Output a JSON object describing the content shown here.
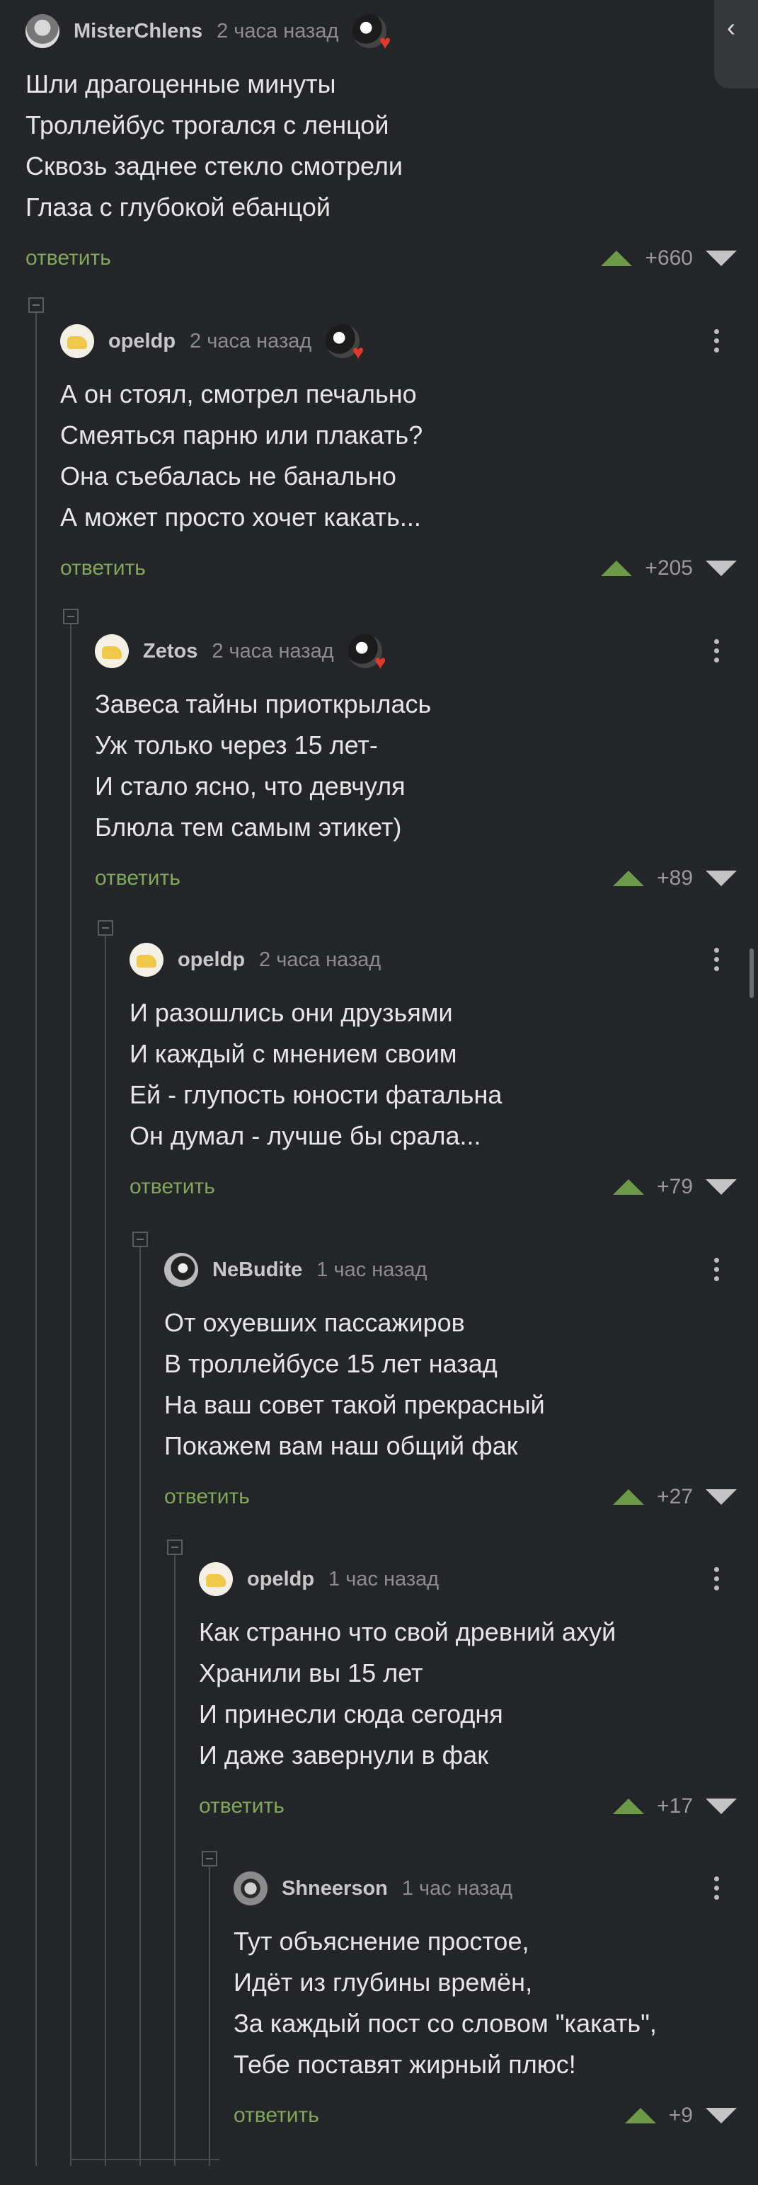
{
  "reply_label": "ответить",
  "comments": [
    {
      "nick": "MisterChlens",
      "time": "2 часа назад",
      "score": "+660",
      "lines": [
        "Шли драгоценные минуты",
        "Троллейбус трогался с ленцой",
        "Сквозь заднее стекло смотрели",
        "Глаза с глубокой ебанцой"
      ]
    },
    {
      "nick": "opeldp",
      "time": "2 часа назад",
      "score": "+205",
      "lines": [
        "А он стоял, смотрел печально",
        "Смеяться парню или плакать?",
        "Она съебалась не банально",
        "А может просто хочет какать..."
      ]
    },
    {
      "nick": "Zetos",
      "time": "2 часа назад",
      "score": "+89",
      "lines": [
        "Завеса тайны приоткрылась",
        "Уж только через 15 лет-",
        "И стало ясно, что девчуля",
        "Блюла тем самым этикет)"
      ]
    },
    {
      "nick": "opeldp",
      "time": "2 часа назад",
      "score": "+79",
      "lines": [
        "И разошлись они друзьями",
        "И каждый с мнением своим",
        "Ей - глупость юности фатальна",
        "Он думал - лучше бы срала..."
      ]
    },
    {
      "nick": "NeBudite",
      "time": "1 час назад",
      "score": "+27",
      "lines": [
        "От охуевших пассажиров",
        "В троллейбусе 15 лет назад",
        "На ваш совет такой прекрасный",
        "Покажем вам наш общий фак"
      ]
    },
    {
      "nick": "opeldp",
      "time": "1 час назад",
      "score": "+17",
      "lines": [
        "Как странно что свой древний ахуй",
        "Хранили вы 15 лет",
        "И принесли сюда сегодня",
        "И даже завернули в фак"
      ]
    },
    {
      "nick": "Shneerson",
      "time": "1 час назад",
      "score": "+9",
      "lines": [
        "Тут объяснение простое,",
        "Идёт из глубины времён,",
        "За каждый пост со словом \"какать\",",
        "Тебе поставят жирный плюс!"
      ]
    }
  ]
}
